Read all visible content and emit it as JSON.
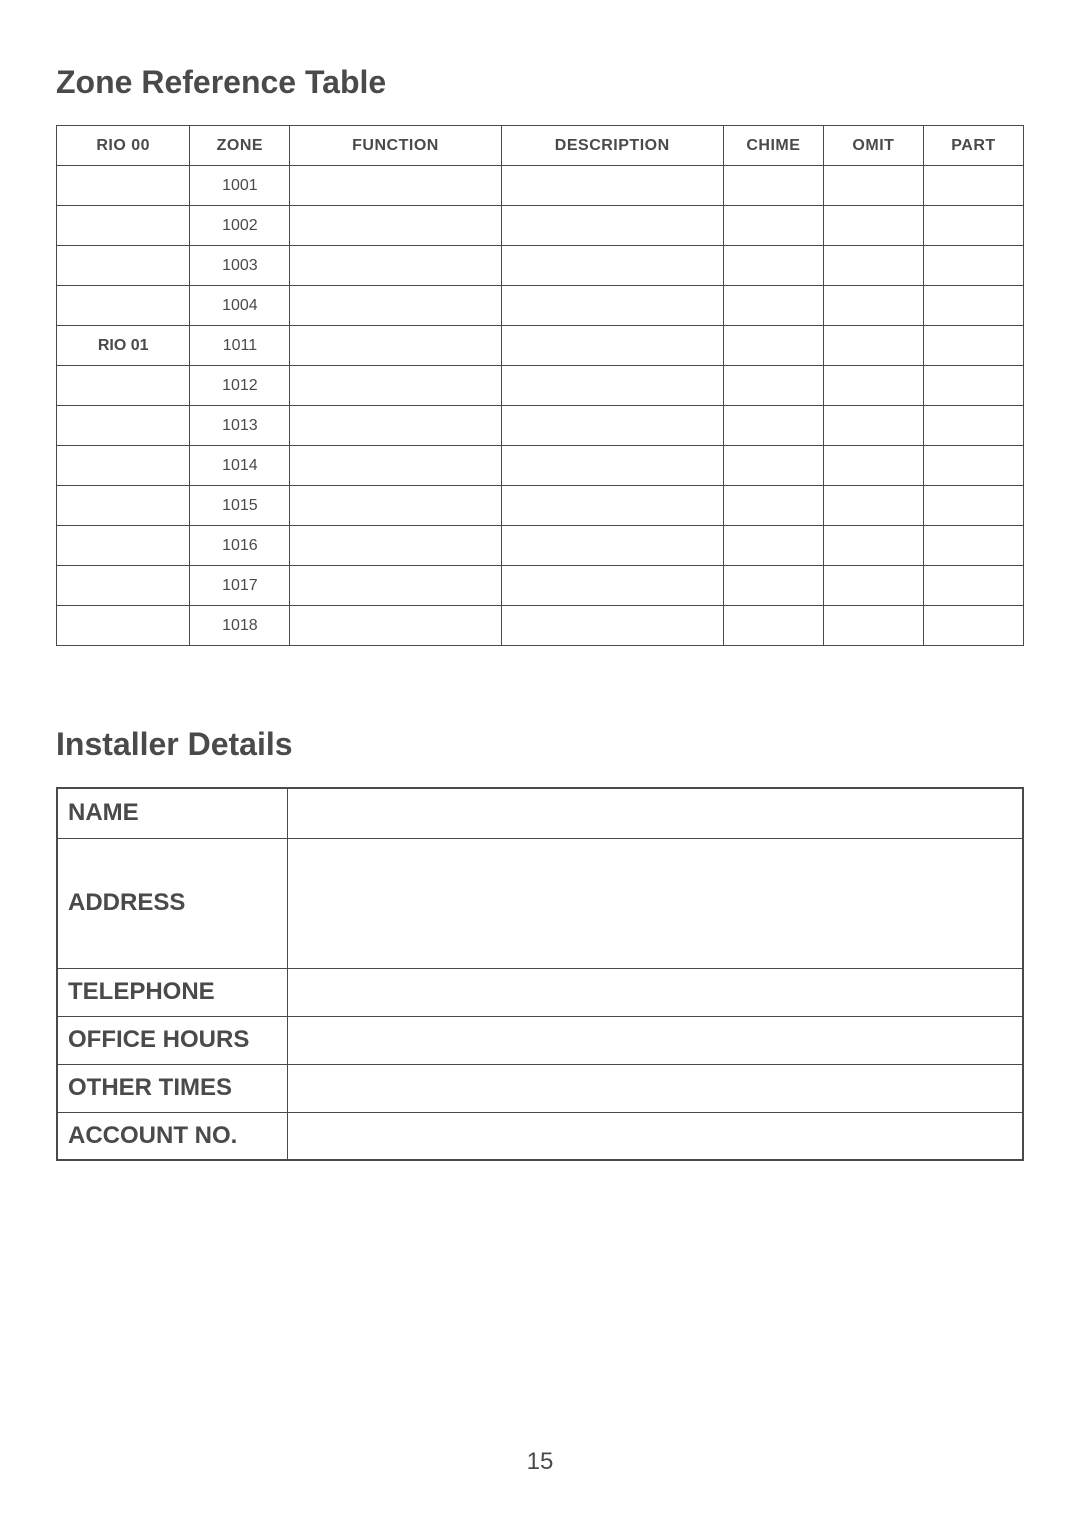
{
  "zone_section": {
    "title": "Zone Reference Table",
    "headers": {
      "rio": "RIO 00",
      "zone": "ZONE",
      "function": "FUNCTION",
      "description": "DESCRIPTION",
      "chime": "CHIME",
      "omit": "OMIT",
      "part": "PART"
    },
    "rows": [
      {
        "rio": "",
        "zone": "1001",
        "function": "",
        "description": "",
        "chime": "",
        "omit": "",
        "part": ""
      },
      {
        "rio": "",
        "zone": "1002",
        "function": "",
        "description": "",
        "chime": "",
        "omit": "",
        "part": ""
      },
      {
        "rio": "",
        "zone": "1003",
        "function": "",
        "description": "",
        "chime": "",
        "omit": "",
        "part": ""
      },
      {
        "rio": "",
        "zone": "1004",
        "function": "",
        "description": "",
        "chime": "",
        "omit": "",
        "part": ""
      },
      {
        "rio": "RIO 01",
        "zone": "1011",
        "function": "",
        "description": "",
        "chime": "",
        "omit": "",
        "part": ""
      },
      {
        "rio": "",
        "zone": "1012",
        "function": "",
        "description": "",
        "chime": "",
        "omit": "",
        "part": ""
      },
      {
        "rio": "",
        "zone": "1013",
        "function": "",
        "description": "",
        "chime": "",
        "omit": "",
        "part": ""
      },
      {
        "rio": "",
        "zone": "1014",
        "function": "",
        "description": "",
        "chime": "",
        "omit": "",
        "part": ""
      },
      {
        "rio": "",
        "zone": "1015",
        "function": "",
        "description": "",
        "chime": "",
        "omit": "",
        "part": ""
      },
      {
        "rio": "",
        "zone": "1016",
        "function": "",
        "description": "",
        "chime": "",
        "omit": "",
        "part": ""
      },
      {
        "rio": "",
        "zone": "1017",
        "function": "",
        "description": "",
        "chime": "",
        "omit": "",
        "part": ""
      },
      {
        "rio": "",
        "zone": "1018",
        "function": "",
        "description": "",
        "chime": "",
        "omit": "",
        "part": ""
      }
    ]
  },
  "installer_section": {
    "title": "Installer Details",
    "rows": [
      {
        "label": "NAME",
        "value": "",
        "cls": "row-name"
      },
      {
        "label": "ADDRESS",
        "value": "",
        "cls": "row-address"
      },
      {
        "label": "TELEPHONE",
        "value": "",
        "cls": "row-regular"
      },
      {
        "label": "OFFICE HOURS",
        "value": "",
        "cls": "row-regular"
      },
      {
        "label": "OTHER TIMES",
        "value": "",
        "cls": "row-regular"
      },
      {
        "label": "ACCOUNT NO.",
        "value": "",
        "cls": "row-regular"
      }
    ]
  },
  "page_number": "15"
}
